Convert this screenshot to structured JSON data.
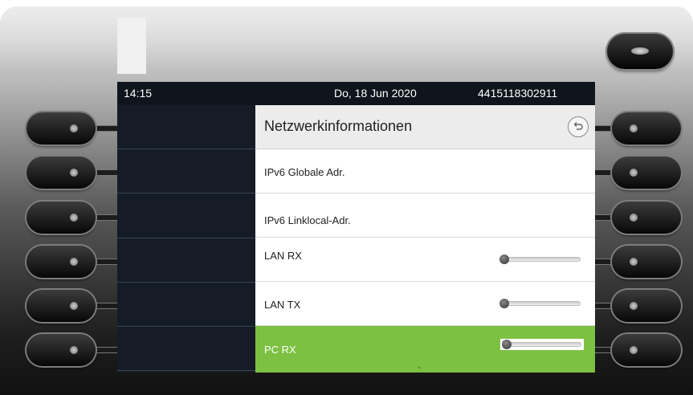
{
  "status_bar": {
    "time": "14:15",
    "date": "Do, 18 Jun 2020",
    "number": "4415118302911"
  },
  "panel": {
    "title": "Netzwerkinformationen",
    "back_icon": "back-arrow-icon",
    "rows": [
      {
        "label": "IPv6 Globale Adr."
      },
      {
        "label": "IPv6 Linklocal-Adr."
      },
      {
        "label": "LAN RX",
        "level": 0.04
      },
      {
        "label": "LAN TX",
        "level": 0.04
      },
      {
        "label": "PC RX",
        "level": 0.04,
        "selected": true
      }
    ],
    "scroll_indicator": "⌄"
  },
  "colors": {
    "selected_row": "#7dc142",
    "screen_bg": "#121821",
    "header_bg": "#ececec"
  }
}
